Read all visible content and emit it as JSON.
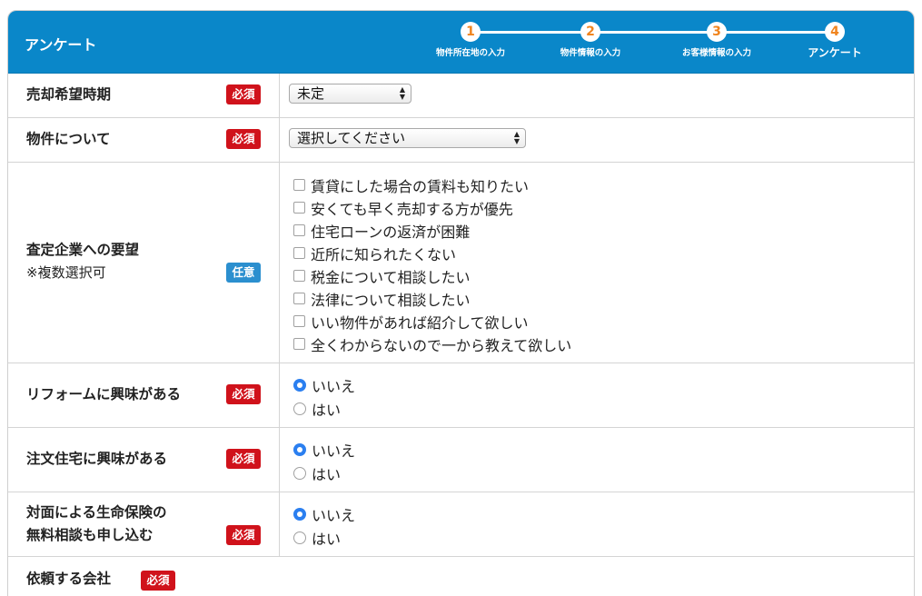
{
  "header": {
    "title": "アンケート",
    "steps": [
      {
        "num": "1",
        "label": "物件所在地の入力"
      },
      {
        "num": "2",
        "label": "物件情報の入力"
      },
      {
        "num": "3",
        "label": "お客様情報の入力"
      },
      {
        "num": "4",
        "label": "アンケート"
      }
    ]
  },
  "badges": {
    "required": "必須",
    "optional": "任意"
  },
  "rows": {
    "sale_timing": {
      "label": "売却希望時期",
      "value": "未定"
    },
    "property": {
      "label": "物件について",
      "value": "選択してください"
    },
    "requests": {
      "label": "査定企業への要望",
      "sub": "※複数選択可",
      "options": [
        "賃貸にした場合の賃料も知りたい",
        "安くても早く売却する方が優先",
        "住宅ローンの返済が困難",
        "近所に知られたくない",
        "税金について相談したい",
        "法律について相談したい",
        "いい物件があれば紹介して欲しい",
        "全くわからないので一から教えて欲しい"
      ]
    },
    "reform": {
      "label": "リフォームに興味がある",
      "options": [
        "いいえ",
        "はい"
      ],
      "selected": "いいえ"
    },
    "custom_home": {
      "label": "注文住宅に興味がある",
      "options": [
        "いいえ",
        "はい"
      ],
      "selected": "いいえ"
    },
    "insurance": {
      "label_line1": "対面による生命保険の",
      "label_line2": "無料相談も申し込む",
      "options": [
        "いいえ",
        "はい"
      ],
      "selected": "いいえ"
    },
    "company": {
      "label": "依頼する会社"
    }
  }
}
